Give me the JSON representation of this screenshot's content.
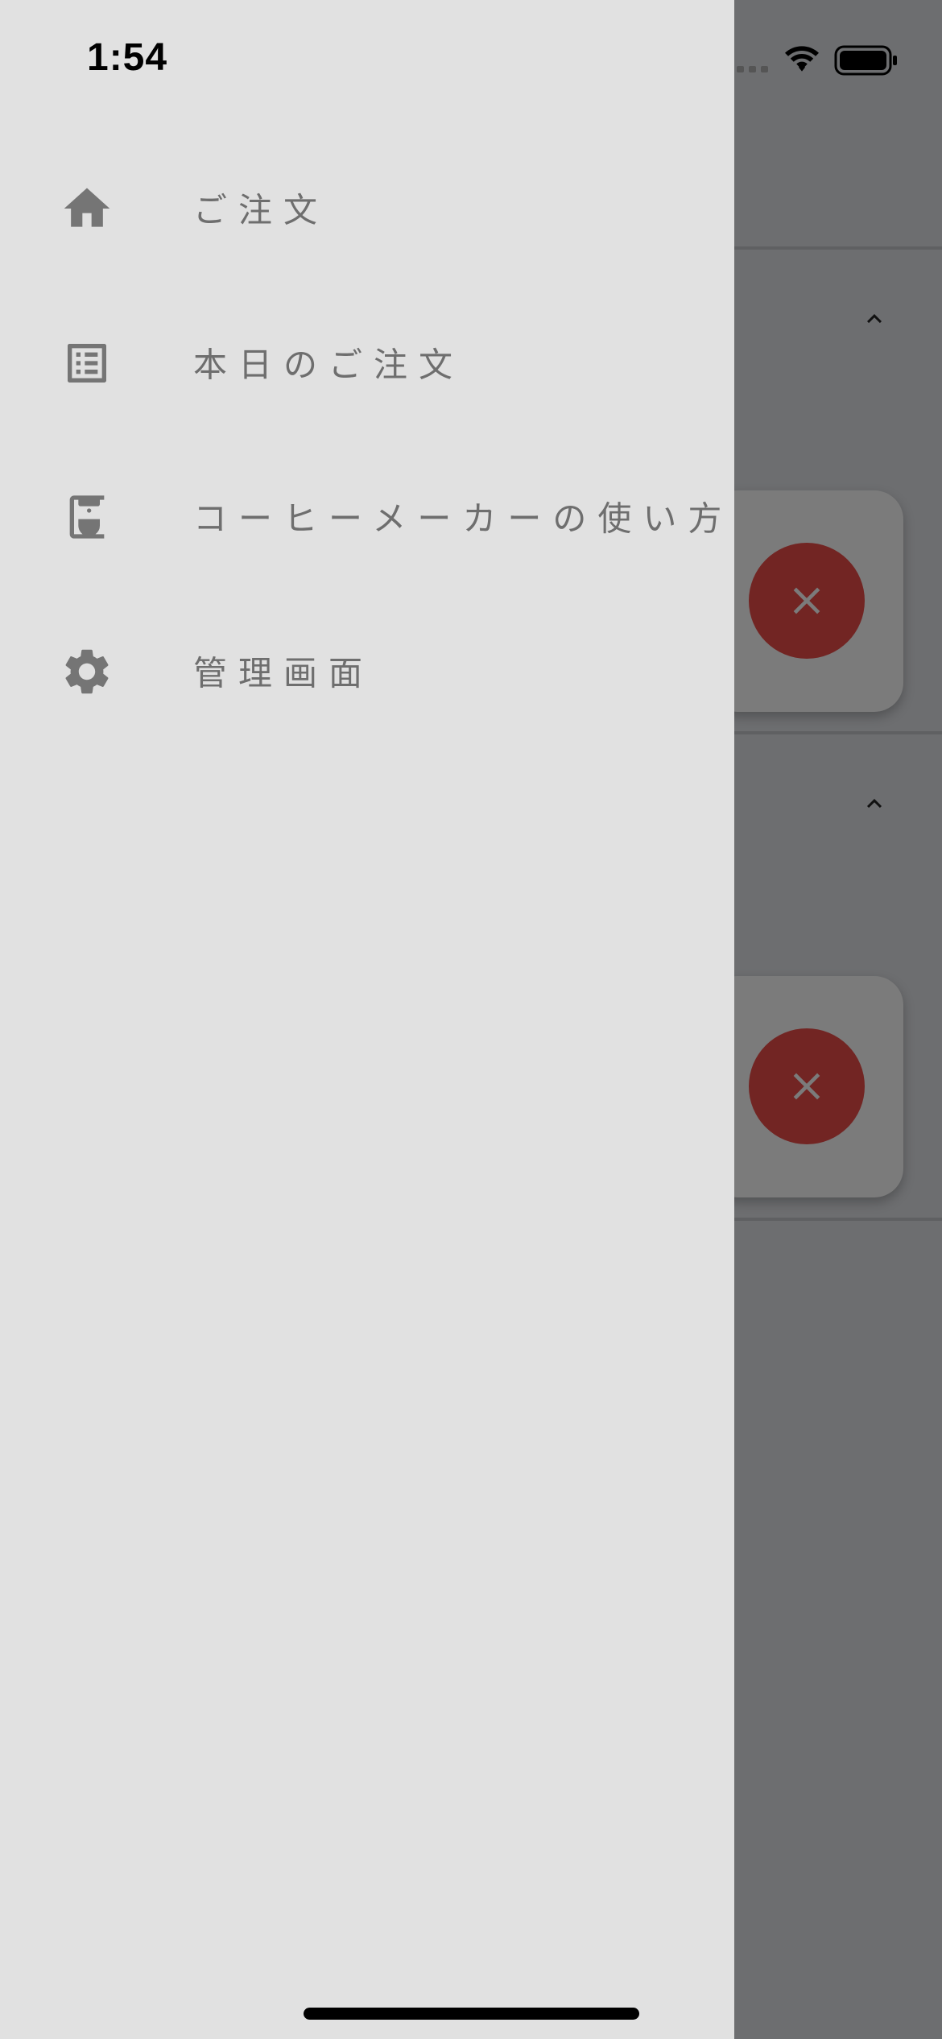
{
  "status_bar": {
    "time": "1:54",
    "icons": [
      "cellular-signal-icon",
      "wifi-icon",
      "battery-icon"
    ]
  },
  "drawer": {
    "menu": [
      {
        "icon": "home-icon",
        "label": "ご注文"
      },
      {
        "icon": "list-icon",
        "label": "本日のご注文"
      },
      {
        "icon": "coffee-maker-icon",
        "label": "コーヒーメーカーの使い方"
      },
      {
        "icon": "gear-icon",
        "label": "管理画面"
      }
    ]
  },
  "background": {
    "chevron_icon": "chevron-up-icon",
    "cancel_icon": "close-icon"
  },
  "colors": {
    "drawer_bg": "#e1e1e1",
    "scrim_bg": "#6d6e70",
    "icon_gray": "#757575",
    "cancel_red": "#722523"
  }
}
